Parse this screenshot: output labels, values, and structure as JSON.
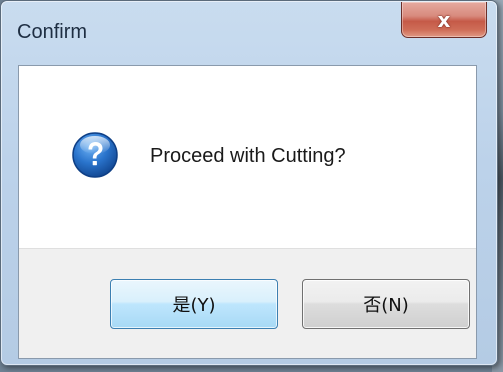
{
  "dialog": {
    "title": "Confirm",
    "close_glyph": "x",
    "message": "Proceed with Cutting?",
    "icon": "question-icon",
    "buttons": {
      "yes_label": "是(Y)",
      "no_label": "否(N)"
    }
  },
  "colors": {
    "titlebar": "#bcd2ea",
    "close_button": "#c55a48",
    "default_button_border": "#3c7fb1",
    "icon_blue": "#1f5fb0"
  }
}
